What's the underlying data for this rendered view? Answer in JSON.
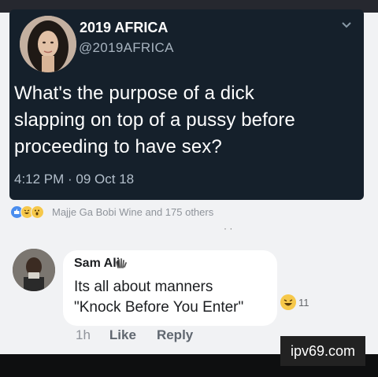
{
  "tweet": {
    "name": "2019 AFRICA",
    "handle": "@2019AFRICA",
    "text_lines": [
      "What's the purpose of a dick",
      "slapping on top of a pussy before",
      "proceeding to have sex?"
    ],
    "timestamp": "4:12 PM · 09 Oct 18",
    "menu_icon": "chevron-down-icon"
  },
  "reactions": {
    "icons": [
      "like-icon",
      "haha-icon",
      "wow-icon"
    ],
    "summary": "Majje Ga Bobi Wine and 175 others"
  },
  "comment": {
    "author": "Sam Ali",
    "author_icon": "wave-hand-icon",
    "lines": [
      "Its all about manners",
      "\"Knock Before You Enter\""
    ],
    "reaction_icon": "haha-icon",
    "reaction_count": "11",
    "time_ago": "1h",
    "like_label": "Like",
    "reply_label": "Reply"
  },
  "watermark": "ipv69.com"
}
